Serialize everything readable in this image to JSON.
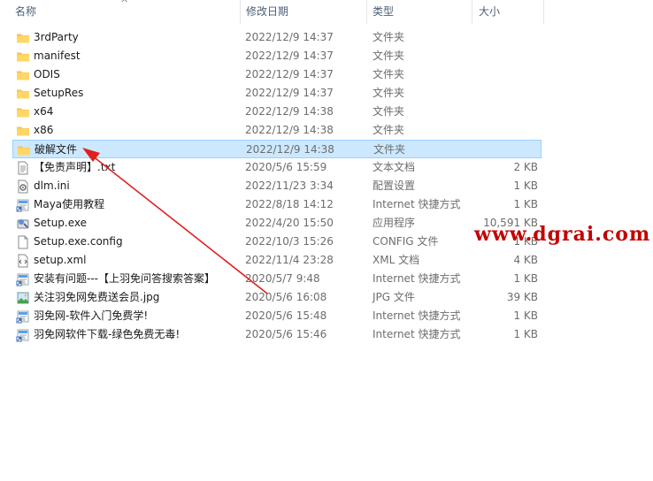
{
  "columns": {
    "name": "名称",
    "modified": "修改日期",
    "type": "类型",
    "size": "大小"
  },
  "colors": {
    "folder": "#ffd766",
    "selection": "#cce8ff",
    "arrow": "#e02020",
    "watermark": "#c40000"
  },
  "files": [
    {
      "name": "3rdParty",
      "modified": "2022/12/9 14:37",
      "type": "文件夹",
      "size": "",
      "icon": "folder-icon"
    },
    {
      "name": "manifest",
      "modified": "2022/12/9 14:37",
      "type": "文件夹",
      "size": "",
      "icon": "folder-icon"
    },
    {
      "name": "ODIS",
      "modified": "2022/12/9 14:37",
      "type": "文件夹",
      "size": "",
      "icon": "folder-icon"
    },
    {
      "name": "SetupRes",
      "modified": "2022/12/9 14:37",
      "type": "文件夹",
      "size": "",
      "icon": "folder-icon"
    },
    {
      "name": "x64",
      "modified": "2022/12/9 14:38",
      "type": "文件夹",
      "size": "",
      "icon": "folder-icon"
    },
    {
      "name": "x86",
      "modified": "2022/12/9 14:38",
      "type": "文件夹",
      "size": "",
      "icon": "folder-icon"
    },
    {
      "name": "破解文件",
      "modified": "2022/12/9 14:38",
      "type": "文件夹",
      "size": "",
      "icon": "folder-icon",
      "selected": true
    },
    {
      "name": "【免责声明】.txt",
      "modified": "2020/5/6 15:59",
      "type": "文本文档",
      "size": "2 KB",
      "icon": "text-file-icon"
    },
    {
      "name": "dlm.ini",
      "modified": "2022/11/23 3:34",
      "type": "配置设置",
      "size": "1 KB",
      "icon": "ini-file-icon"
    },
    {
      "name": "Maya使用教程",
      "modified": "2022/8/18 14:12",
      "type": "Internet 快捷方式",
      "size": "1 KB",
      "icon": "internet-shortcut-icon"
    },
    {
      "name": "Setup.exe",
      "modified": "2022/4/20 15:50",
      "type": "应用程序",
      "size": "10,591 KB",
      "icon": "setup-exe-icon"
    },
    {
      "name": "Setup.exe.config",
      "modified": "2022/10/3 15:26",
      "type": "CONFIG 文件",
      "size": "1 KB",
      "icon": "blank-file-icon"
    },
    {
      "name": "setup.xml",
      "modified": "2022/11/4 23:28",
      "type": "XML 文档",
      "size": "4 KB",
      "icon": "xml-file-icon"
    },
    {
      "name": "安装有问题---【上羽免问答搜索答案】",
      "modified": "2020/5/7 9:48",
      "type": "Internet 快捷方式",
      "size": "1 KB",
      "icon": "internet-shortcut-icon"
    },
    {
      "name": "关注羽免网免费送会员.jpg",
      "modified": "2020/5/6 16:08",
      "type": "JPG 文件",
      "size": "39 KB",
      "icon": "image-file-icon"
    },
    {
      "name": "羽免网-软件入门免费学!",
      "modified": "2020/5/6 15:48",
      "type": "Internet 快捷方式",
      "size": "1 KB",
      "icon": "internet-shortcut-icon"
    },
    {
      "name": "羽免网软件下载-绿色免费无毒!",
      "modified": "2020/5/6 15:46",
      "type": "Internet 快捷方式",
      "size": "1 KB",
      "icon": "internet-shortcut-icon"
    }
  ],
  "watermark": "www.dgrai.com"
}
